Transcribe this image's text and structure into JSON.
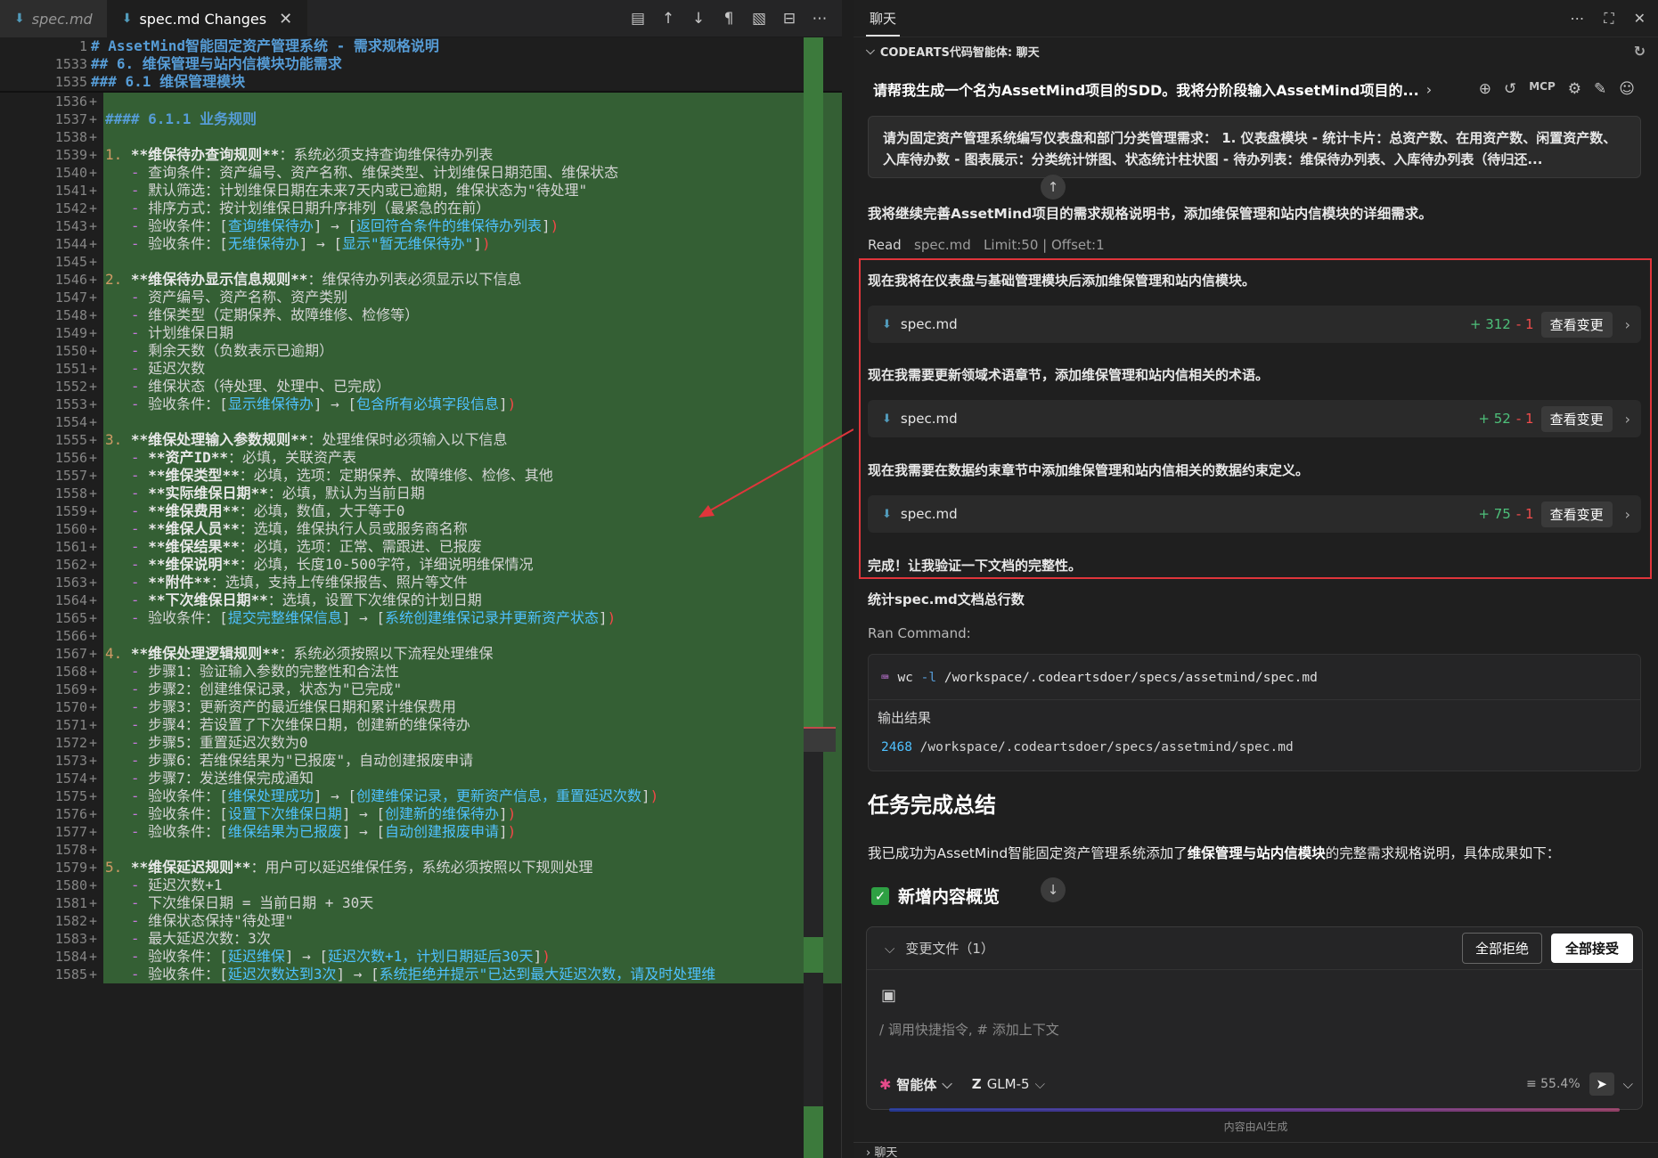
{
  "editor": {
    "tabs": [
      {
        "label": "spec.md",
        "active": false,
        "italic": true
      },
      {
        "label": "spec.md Changes",
        "active": true,
        "italic": false
      }
    ],
    "toolbar_icons": [
      "layout-icon",
      "arrow-up-icon",
      "arrow-down-icon",
      "pilcrow-icon",
      "map-icon",
      "split-icon",
      "more-icon"
    ],
    "sticky": [
      {
        "num": "1",
        "html": "<span class='hd'># AssetMind智能固定资产管理系统 - 需求规格说明</span>"
      },
      {
        "num": "1533",
        "html": "<span class='hd'>## 6. 维保管理与站内信模块功能需求</span>"
      },
      {
        "num": "1535",
        "html": "<span class='hd'>### 6.1 维保管理模块</span>"
      }
    ],
    "lines": [
      {
        "num": "1536",
        "html": ""
      },
      {
        "num": "1537",
        "html": "<span class='hd'>#### 6.1.1 业务规则</span>"
      },
      {
        "num": "1538",
        "html": ""
      },
      {
        "num": "1539",
        "html": "<span class='num'>1.</span> <span class='bold'>**维保待办查询规则**</span>：系统必须支持查询维保待办列表"
      },
      {
        "num": "1540",
        "html": "   <span class='dash'>-</span> 查询条件：资产编号、资产名称、维保类型、计划维保日期范围、维保状态"
      },
      {
        "num": "1541",
        "html": "   <span class='dash'>-</span> 默认筛选：计划维保日期在未来7天内或已逾期，维保状态为\"待处理\""
      },
      {
        "num": "1542",
        "html": "   <span class='dash'>-</span> 排序方式：按计划维保日期升序排列（最紧急的在前）"
      },
      {
        "num": "1543",
        "html": "   <span class='dash'>-</span> 验收条件：[<span class='link'>查询维保待办</span>] → [<span class='link'>返回符合条件的维保待办列表</span>]<span class='br'>)</span>"
      },
      {
        "num": "1544",
        "html": "   <span class='dash'>-</span> 验收条件：[<span class='link'>无维保待办</span>] → [<span class='link'>显示\"暂无维保待办\"</span>]<span class='br'>)</span>"
      },
      {
        "num": "1545",
        "html": ""
      },
      {
        "num": "1546",
        "html": "<span class='num'>2.</span> <span class='bold'>**维保待办显示信息规则**</span>：维保待办列表必须显示以下信息"
      },
      {
        "num": "1547",
        "html": "   <span class='dash'>-</span> 资产编号、资产名称、资产类别"
      },
      {
        "num": "1548",
        "html": "   <span class='dash'>-</span> 维保类型（定期保养、故障维修、检修等）"
      },
      {
        "num": "1549",
        "html": "   <span class='dash'>-</span> 计划维保日期"
      },
      {
        "num": "1550",
        "html": "   <span class='dash'>-</span> 剩余天数（负数表示已逾期）"
      },
      {
        "num": "1551",
        "html": "   <span class='dash'>-</span> 延迟次数"
      },
      {
        "num": "1552",
        "html": "   <span class='dash'>-</span> 维保状态（待处理、处理中、已完成）"
      },
      {
        "num": "1553",
        "html": "   <span class='dash'>-</span> 验收条件：[<span class='link'>显示维保待办</span>] → [<span class='link'>包含所有必填字段信息</span>]<span class='br'>)</span>"
      },
      {
        "num": "1554",
        "html": ""
      },
      {
        "num": "1555",
        "html": "<span class='num'>3.</span> <span class='bold'>**维保处理输入参数规则**</span>：处理维保时必须输入以下信息"
      },
      {
        "num": "1556",
        "html": "   <span class='dash'>-</span> <span class='bold'>**资产ID**</span>：必填，关联资产表"
      },
      {
        "num": "1557",
        "html": "   <span class='dash'>-</span> <span class='bold'>**维保类型**</span>：必填，选项：定期保养、故障维修、检修、其他"
      },
      {
        "num": "1558",
        "html": "   <span class='dash'>-</span> <span class='bold'>**实际维保日期**</span>：必填，默认为当前日期"
      },
      {
        "num": "1559",
        "html": "   <span class='dash'>-</span> <span class='bold'>**维保费用**</span>：必填，数值，大于等于0"
      },
      {
        "num": "1560",
        "html": "   <span class='dash'>-</span> <span class='bold'>**维保人员**</span>：选填，维保执行人员或服务商名称"
      },
      {
        "num": "1561",
        "html": "   <span class='dash'>-</span> <span class='bold'>**维保结果**</span>：必填，选项：正常、需跟进、已报废"
      },
      {
        "num": "1562",
        "html": "   <span class='dash'>-</span> <span class='bold'>**维保说明**</span>：必填，长度10-500字符，详细说明维保情况"
      },
      {
        "num": "1563",
        "html": "   <span class='dash'>-</span> <span class='bold'>**附件**</span>：选填，支持上传维保报告、照片等文件"
      },
      {
        "num": "1564",
        "html": "   <span class='dash'>-</span> <span class='bold'>**下次维保日期**</span>：选填，设置下次维保的计划日期"
      },
      {
        "num": "1565",
        "html": "   <span class='dash'>-</span> 验收条件：[<span class='link'>提交完整维保信息</span>] → [<span class='link'>系统创建维保记录并更新资产状态</span>]<span class='br'>)</span>"
      },
      {
        "num": "1566",
        "html": ""
      },
      {
        "num": "1567",
        "html": "<span class='num'>4.</span> <span class='bold'>**维保处理逻辑规则**</span>：系统必须按照以下流程处理维保"
      },
      {
        "num": "1568",
        "html": "   <span class='dash'>-</span> 步骤1：验证输入参数的完整性和合法性"
      },
      {
        "num": "1569",
        "html": "   <span class='dash'>-</span> 步骤2：创建维保记录，状态为\"已完成\""
      },
      {
        "num": "1570",
        "html": "   <span class='dash'>-</span> 步骤3：更新资产的最近维保日期和累计维保费用"
      },
      {
        "num": "1571",
        "html": "   <span class='dash'>-</span> 步骤4：若设置了下次维保日期，创建新的维保待办"
      },
      {
        "num": "1572",
        "html": "   <span class='dash'>-</span> 步骤5：重置延迟次数为0"
      },
      {
        "num": "1573",
        "html": "   <span class='dash'>-</span> 步骤6：若维保结果为\"已报废\"，自动创建报废申请"
      },
      {
        "num": "1574",
        "html": "   <span class='dash'>-</span> 步骤7：发送维保完成通知"
      },
      {
        "num": "1575",
        "html": "   <span class='dash'>-</span> 验收条件：[<span class='link'>维保处理成功</span>] → [<span class='link'>创建维保记录，更新资产信息，重置延迟次数</span>]<span class='br'>)</span>"
      },
      {
        "num": "1576",
        "html": "   <span class='dash'>-</span> 验收条件：[<span class='link'>设置下次维保日期</span>] → [<span class='link'>创建新的维保待办</span>]<span class='br'>)</span>"
      },
      {
        "num": "1577",
        "html": "   <span class='dash'>-</span> 验收条件：[<span class='link'>维保结果为已报废</span>] → [<span class='link'>自动创建报废申请</span>]<span class='br'>)</span>"
      },
      {
        "num": "1578",
        "html": ""
      },
      {
        "num": "1579",
        "html": "<span class='num'>5.</span> <span class='bold'>**维保延迟规则**</span>：用户可以延迟维保任务，系统必须按照以下规则处理"
      },
      {
        "num": "1580",
        "html": "   <span class='dash'>-</span> 延迟次数+1"
      },
      {
        "num": "1581",
        "html": "   <span class='dash'>-</span> 下次维保日期 = 当前日期 + 30天"
      },
      {
        "num": "1582",
        "html": "   <span class='dash'>-</span> 维保状态保持\"待处理\""
      },
      {
        "num": "1583",
        "html": "   <span class='dash'>-</span> 最大延迟次数：3次"
      },
      {
        "num": "1584",
        "html": "   <span class='dash'>-</span> 验收条件：[<span class='link'>延迟维保</span>] → [<span class='link'>延迟次数+1，计划日期延后30天</span>]<span class='br'>)</span>"
      },
      {
        "num": "1585",
        "html": "   <span class='dash'>-</span> 验收条件：[<span class='link'>延迟次数达到3次</span>] → [<span class='link'>系统拒绝并提示\"已达到最大延迟次数，请及时处理维</span>"
      }
    ]
  },
  "chat": {
    "panel_title": "聊天",
    "agent_header": "CODEARTS代码智能体: 聊天",
    "question": "请帮我生成一个名为AssetMind项目的SDD。我将分阶段输入AssetMind项目的...",
    "prompt_text": "请为固定资产管理系统编写仪表盘和部门分类管理需求： 1. 仪表盘模块 - 统计卡片：总资产数、在用资产数、闲置资产数、入库待办数 - 图表展示：分类统计饼图、状态统计柱状图 - 待办列表：维保待办列表、入库待办列表（待归还...",
    "continue_text": "我将继续完善AssetMind项目的需求规格说明书，添加维保管理和站内信模块的详细需求。",
    "read_label": "Read",
    "read_file": "spec.md",
    "read_limit": "Limit:50 | Offset:1",
    "step1": "现在我将在仪表盘与基础管理模块后添加维保管理和站内信模块。",
    "step2": "现在我需要更新领域术语章节，添加维保管理和站内信相关的术语。",
    "step3": "现在我需要在数据约束章节中添加维保管理和站内信相关的数据约束定义。",
    "files": [
      {
        "name": "spec.md",
        "added": "+ 312",
        "removed": "- 1",
        "view": "查看变更"
      },
      {
        "name": "spec.md",
        "added": "+ 52",
        "removed": "- 1",
        "view": "查看变更"
      },
      {
        "name": "spec.md",
        "added": "+ 75",
        "removed": "- 1",
        "view": "查看变更"
      }
    ],
    "done_text": "完成！让我验证一下文档的完整性。",
    "count_text": "统计spec.md文档总行数",
    "ran_command": "Ran Command:",
    "cmd_name": "wc",
    "cmd_flag": "-l",
    "cmd_path": "/workspace/.codeartsdoer/specs/assetmind/spec.md",
    "output_label": "输出结果",
    "output_count": "2468",
    "output_path": "/workspace/.codeartsdoer/specs/assetmind/spec.md",
    "summary_title": "任务完成总结",
    "summary_pre": "我已成功为AssetMind智能固定资产管理系统添加了",
    "summary_bold": "维保管理与站内信模块",
    "summary_post": "的完整需求规格说明，具体成果如下：",
    "new_content": "新增内容概览",
    "changed_files": "变更文件（1）",
    "reject_all": "全部拒绝",
    "accept_all": "全部接受",
    "input_placeholder": "/ 调用快捷指令, # 添加上下文",
    "mode": "智能体",
    "model": "GLM-5",
    "usage": "55.4%",
    "ai_generated": "内容由AI生成",
    "footer_label": "聊天"
  }
}
